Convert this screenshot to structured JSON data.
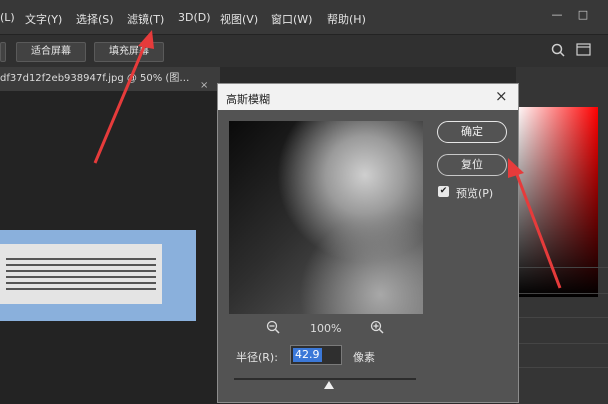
{
  "menu": [
    "(L)",
    "文字(Y)",
    "选择(S)",
    "滤镜(T)",
    "3D(D)",
    "视图(V)",
    "窗口(W)",
    "帮助(H)"
  ],
  "options": {
    "fit_screen": "适合屏幕",
    "fill_screen": "填充屏幕"
  },
  "document_tab": {
    "title": "df37d12f2eb938947f.jpg @ 50% (图…",
    "close": "×"
  },
  "dialog": {
    "title": "高斯模糊",
    "ok": "确定",
    "reset": "复位",
    "preview_checked": true,
    "preview_label": "预览(P)",
    "zoom": "100%",
    "radius_label": "半径(R):",
    "radius_value": "42.9",
    "unit": "像素",
    "radius_slider_fraction": 0.52,
    "close": "×"
  },
  "colors": {
    "annotation_arrow": "#e63b3b",
    "accent_selection": "#3b78d8",
    "picker_hue": "#ff0000"
  },
  "icons": [
    "zoom-out-icon",
    "zoom-in-icon",
    "search-icon",
    "workspace-icon",
    "check-icon",
    "close-icon",
    "minimize-icon",
    "maximize-icon"
  ]
}
